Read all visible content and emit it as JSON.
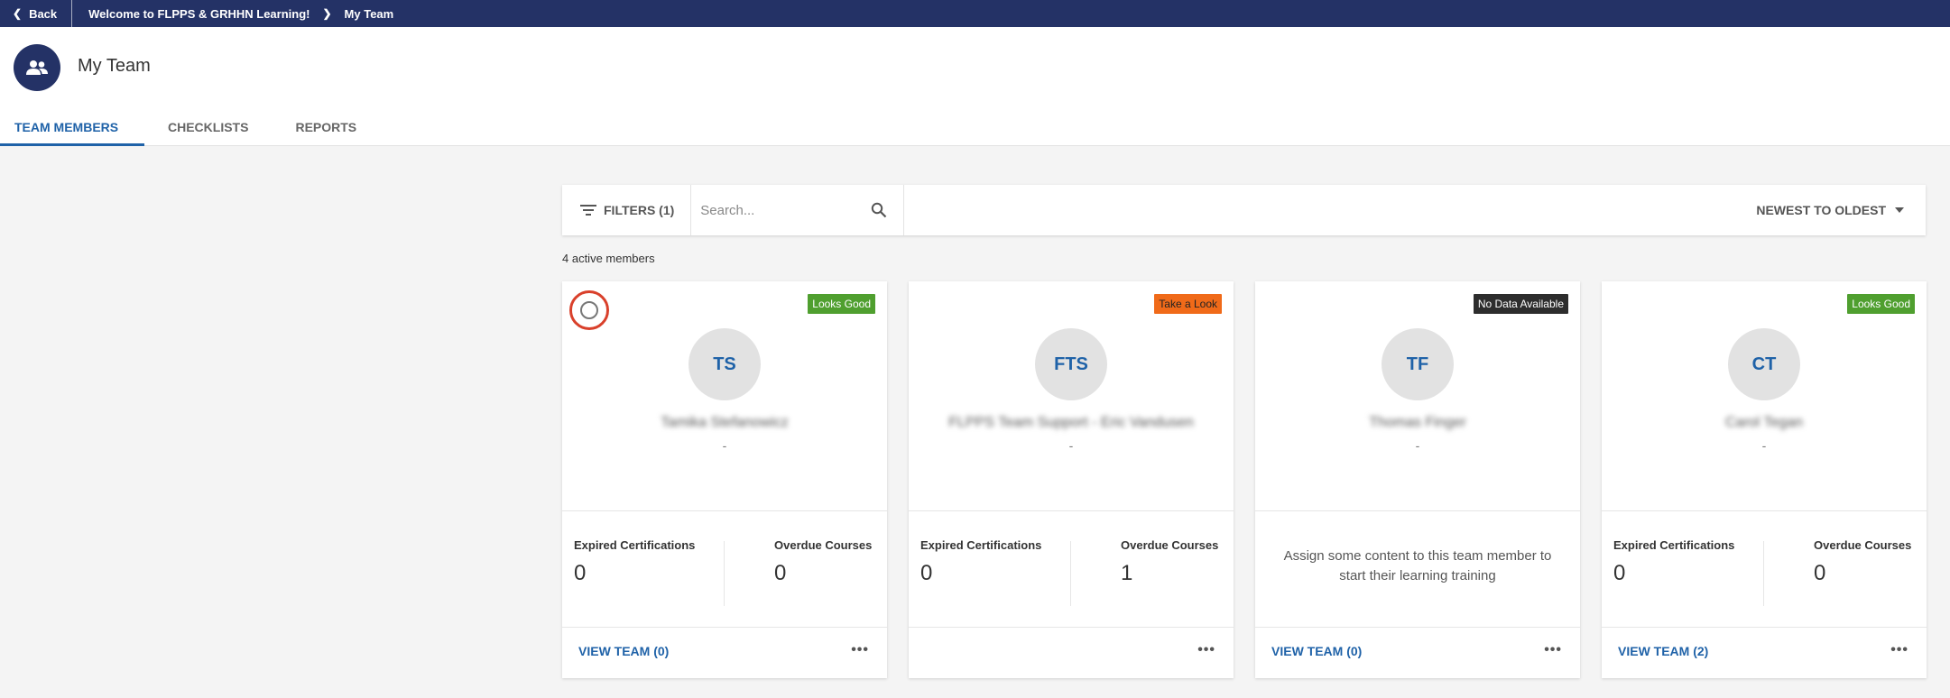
{
  "topbar": {
    "back_label": "Back",
    "breadcrumb": [
      "Welcome to FLPPS & GRHHN Learning!",
      "My Team"
    ]
  },
  "header": {
    "title": "My Team",
    "icon": "team-icon",
    "tabs": [
      {
        "label": "TEAM MEMBERS",
        "active": true
      },
      {
        "label": "CHECKLISTS",
        "active": false
      },
      {
        "label": "REPORTS",
        "active": false
      }
    ]
  },
  "toolbar": {
    "filters_label": "FILTERS (1)",
    "search_placeholder": "Search...",
    "sort_label": "NEWEST TO OLDEST"
  },
  "summary": {
    "active_members": "4 active members"
  },
  "labels": {
    "expired": "Expired Certifications",
    "overdue": "Overdue Courses",
    "more": "•••"
  },
  "colors": {
    "nav": "#243266",
    "accent": "#1f62a8",
    "looks_good": "#4f9f2f",
    "take_a_look": "#f06a19",
    "no_data": "#2d2d2d"
  },
  "members": [
    {
      "initials": "TS",
      "name": "Tamika Stefanowicz",
      "subtitle": "-",
      "status": "Looks Good",
      "expired": "0",
      "overdue": "0",
      "view_team": "VIEW TEAM (0)"
    },
    {
      "initials": "FTS",
      "name": "FLPPS Team Support - Eric Vandusen",
      "subtitle": "-",
      "status": "Take a Look",
      "expired": "0",
      "overdue": "1"
    },
    {
      "initials": "TF",
      "name": "Thomas Finger",
      "subtitle": "-",
      "status": "No Data Available",
      "message": "Assign some content to this team member to start their learning training",
      "view_team": "VIEW TEAM (0)"
    },
    {
      "initials": "CT",
      "name": "Carol Tegan",
      "subtitle": "-",
      "status": "Looks Good",
      "expired": "0",
      "overdue": "0",
      "view_team": "VIEW TEAM (2)"
    }
  ]
}
